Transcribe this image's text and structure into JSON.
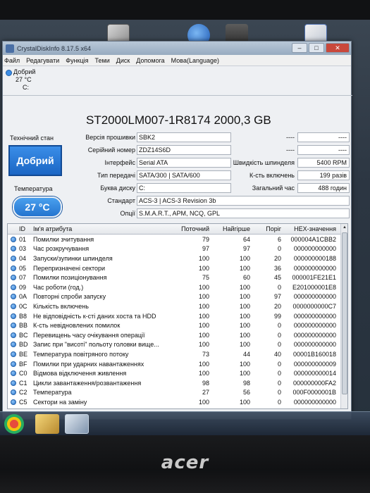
{
  "window": {
    "title": "CrystalDiskInfo 8.17.5 x64",
    "controls": [
      "–",
      "□",
      "✕"
    ]
  },
  "menu": [
    "Файл",
    "Редагувати",
    "Функція",
    "Теми",
    "Диск",
    "Допомога",
    "Мова(Language)"
  ],
  "disk_tab": {
    "status": "Добрий",
    "temp": "27 °C",
    "letter": "C:"
  },
  "drive": {
    "title": "ST2000LM007-1R8174 2000,3 GB"
  },
  "health": {
    "label": "Технічний стан",
    "value": "Добрий",
    "temp_label": "Температура",
    "temp_value": "27 °C"
  },
  "fields": {
    "firmware_label": "Версія прошивки",
    "firmware": "SBK2",
    "serial_label": "Серійний номер",
    "serial": "ZDZ14S6D",
    "interface_label": "Інтерфейс",
    "interface": "Serial ATA",
    "transfer_label": "Тип передачі",
    "transfer": "SATA/300 | SATA/600",
    "letter_label": "Буква диску",
    "letter": "C:",
    "standard_label": "Стандарт",
    "standard": "ACS-3 | ACS-3 Revision 3b",
    "options_label": "Опції",
    "options": "S.M.A.R.T., APM, NCQ, GPL",
    "right1a": "----",
    "right1b": "----",
    "right2a": "----",
    "right2b": "----",
    "rpm_label": "Швидкість шпинделя",
    "rpm": "5400 RPM",
    "power_count_label": "К-сть включень",
    "power_count": "199 разів",
    "hours_label": "Загальний час",
    "hours": "488 годин"
  },
  "table": {
    "headers": [
      "ID",
      "Ім'я атрибута",
      "Поточний",
      "Найгірше",
      "Поріг",
      "HEX-значення"
    ],
    "rows": [
      {
        "id": "01",
        "name": "Помилки зчитування",
        "cur": "79",
        "worst": "64",
        "thr": "6",
        "raw": "000004A1CBB2"
      },
      {
        "id": "03",
        "name": "Час розкручування",
        "cur": "97",
        "worst": "97",
        "thr": "0",
        "raw": "000000000000"
      },
      {
        "id": "04",
        "name": "Запуски/зупинки шпинделя",
        "cur": "100",
        "worst": "100",
        "thr": "20",
        "raw": "000000000188"
      },
      {
        "id": "05",
        "name": "Перепризначені сектори",
        "cur": "100",
        "worst": "100",
        "thr": "36",
        "raw": "000000000000"
      },
      {
        "id": "07",
        "name": "Помилки позиціонування",
        "cur": "75",
        "worst": "60",
        "thr": "45",
        "raw": "000001FE21E1"
      },
      {
        "id": "09",
        "name": "Час роботи (год.)",
        "cur": "100",
        "worst": "100",
        "thr": "0",
        "raw": "E201000001E8"
      },
      {
        "id": "0A",
        "name": "Повторні спроби запуску",
        "cur": "100",
        "worst": "100",
        "thr": "97",
        "raw": "000000000000"
      },
      {
        "id": "0C",
        "name": "Кількість включень",
        "cur": "100",
        "worst": "100",
        "thr": "20",
        "raw": "0000000000C7"
      },
      {
        "id": "B8",
        "name": "Не відповідність к-сті даних хоста та HDD",
        "cur": "100",
        "worst": "100",
        "thr": "99",
        "raw": "000000000000"
      },
      {
        "id": "BB",
        "name": "К-сть невідновлених помилок",
        "cur": "100",
        "worst": "100",
        "thr": "0",
        "raw": "000000000000"
      },
      {
        "id": "BC",
        "name": "Перевищень часу очікування операції",
        "cur": "100",
        "worst": "100",
        "thr": "0",
        "raw": "000000000000"
      },
      {
        "id": "BD",
        "name": "Запис при \"висоті\" польоту головки вище...",
        "cur": "100",
        "worst": "100",
        "thr": "0",
        "raw": "000000000000"
      },
      {
        "id": "BE",
        "name": "Температура повітряного потоку",
        "cur": "73",
        "worst": "44",
        "thr": "40",
        "raw": "00001B160018"
      },
      {
        "id": "BF",
        "name": "Помилки при ударних навантаженнях",
        "cur": "100",
        "worst": "100",
        "thr": "0",
        "raw": "000000000009"
      },
      {
        "id": "C0",
        "name": "Відмова відключення живлення",
        "cur": "100",
        "worst": "100",
        "thr": "0",
        "raw": "000000000014"
      },
      {
        "id": "C1",
        "name": "Цикли завантаження/розвантаження",
        "cur": "98",
        "worst": "98",
        "thr": "0",
        "raw": "000000000FA2"
      },
      {
        "id": "C2",
        "name": "Температура",
        "cur": "27",
        "worst": "56",
        "thr": "0",
        "raw": "000F0000001B"
      },
      {
        "id": "C5",
        "name": "Сектори на заміну",
        "cur": "100",
        "worst": "100",
        "thr": "0",
        "raw": "000000000000"
      }
    ]
  },
  "colors": {
    "good_blue": "#2a7ad6",
    "window_bg": "#eef0f3"
  },
  "brand": "acer"
}
